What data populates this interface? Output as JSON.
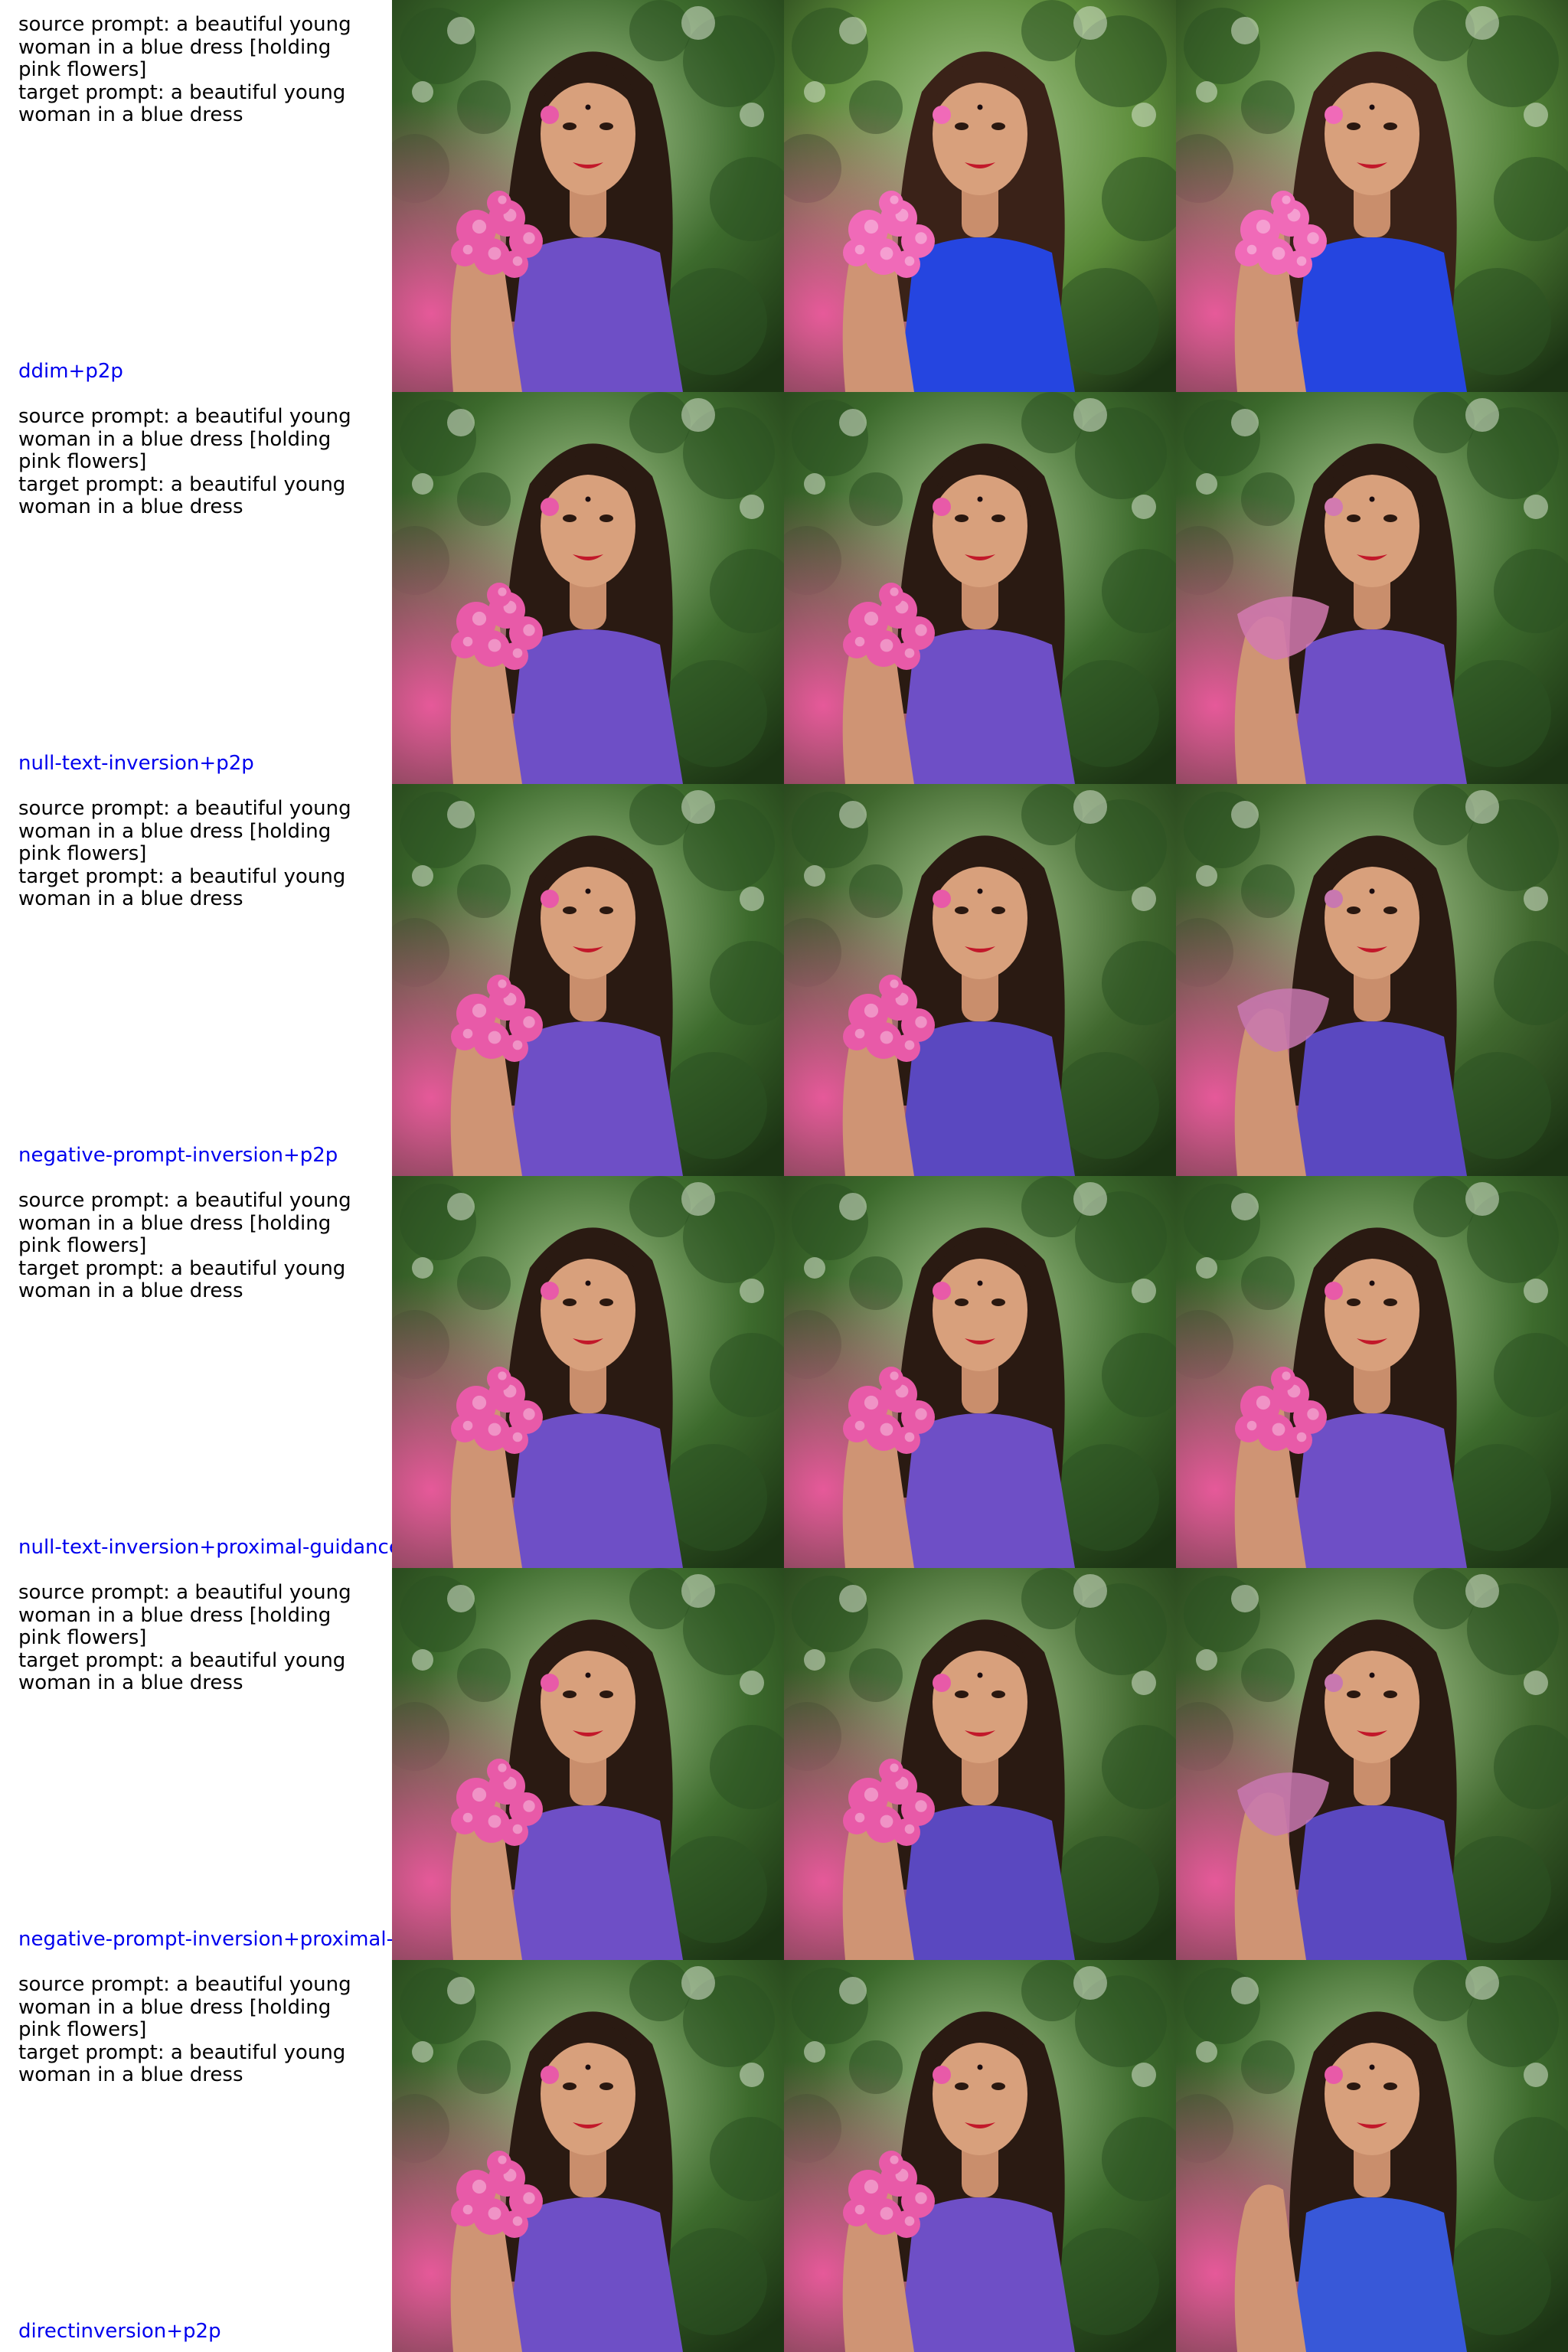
{
  "rows": [
    {
      "source_prompt": "source prompt: a beautiful young woman in a blue dress [holding pink flowers]",
      "target_prompt": "target prompt: a beautiful young woman in a blue dress",
      "method": "ddim+p2p",
      "images": [
        {
          "variant": "source",
          "bg": "#3c6a2c",
          "dress": "#6e4fc6",
          "flowers": "#e85aa8",
          "hair": "#2a1a12",
          "flower_stage": "held"
        },
        {
          "variant": "p2p-reconstruction",
          "bg": "#5c8c3a",
          "dress": "#2545e0",
          "flowers": "#f06ab8",
          "hair": "#3a2218",
          "flower_stage": "held"
        },
        {
          "variant": "edited",
          "bg": "#4e7e34",
          "dress": "#2545e0",
          "flowers": "#f06ab8",
          "hair": "#3a2218",
          "flower_stage": "held"
        }
      ]
    },
    {
      "source_prompt": "source prompt: a beautiful young woman in a blue dress [holding pink flowers]",
      "target_prompt": "target prompt: a beautiful young woman in a blue dress",
      "method": "null-text-inversion+p2p",
      "images": [
        {
          "variant": "source",
          "bg": "#3c6a2c",
          "dress": "#6e4fc6",
          "flowers": "#e85aa8",
          "hair": "#2a1a12",
          "flower_stage": "held"
        },
        {
          "variant": "reconstruction",
          "bg": "#3c6a2c",
          "dress": "#6e4fc6",
          "flowers": "#e85aa8",
          "hair": "#2a1a12",
          "flower_stage": "held"
        },
        {
          "variant": "edited",
          "bg": "#3c6a2c",
          "dress": "#6e4fc6",
          "flowers": "#d27ab0",
          "hair": "#2a1a12",
          "flower_stage": "cloth"
        }
      ]
    },
    {
      "source_prompt": "source prompt: a beautiful young woman in a blue dress [holding pink flowers]",
      "target_prompt": "target prompt: a beautiful young woman in a blue dress",
      "method": "negative-prompt-inversion+p2p",
      "images": [
        {
          "variant": "source",
          "bg": "#3c6a2c",
          "dress": "#6e4fc6",
          "flowers": "#e85aa8",
          "hair": "#2a1a12",
          "flower_stage": "held"
        },
        {
          "variant": "reconstruction",
          "bg": "#40682e",
          "dress": "#5a48c0",
          "flowers": "#e85aa8",
          "hair": "#2a1a12",
          "flower_stage": "held"
        },
        {
          "variant": "edited",
          "bg": "#40682e",
          "dress": "#5a48c0",
          "flowers": "#c878b0",
          "hair": "#2a1a12",
          "flower_stage": "cloth"
        }
      ]
    },
    {
      "source_prompt": "source prompt: a beautiful young woman in a blue dress [holding pink flowers]",
      "target_prompt": "target prompt: a beautiful young woman in a blue dress",
      "method": "null-text-inversion+proximal-guidance",
      "images": [
        {
          "variant": "source",
          "bg": "#3c6a2c",
          "dress": "#6e4fc6",
          "flowers": "#e85aa8",
          "hair": "#2a1a12",
          "flower_stage": "held"
        },
        {
          "variant": "reconstruction",
          "bg": "#3c6a2c",
          "dress": "#6e4fc6",
          "flowers": "#e85aa8",
          "hair": "#2a1a12",
          "flower_stage": "held"
        },
        {
          "variant": "edited",
          "bg": "#3c6a2c",
          "dress": "#6e4fc6",
          "flowers": "#e85aa8",
          "hair": "#2a1a12",
          "flower_stage": "held"
        }
      ]
    },
    {
      "source_prompt": "source prompt: a beautiful young woman in a blue dress [holding pink flowers]",
      "target_prompt": "target prompt: a beautiful young woman in a blue dress",
      "method": "negative-prompt-inversion+proximal-g",
      "images": [
        {
          "variant": "source",
          "bg": "#3c6a2c",
          "dress": "#6e4fc6",
          "flowers": "#e85aa8",
          "hair": "#2a1a12",
          "flower_stage": "held"
        },
        {
          "variant": "reconstruction",
          "bg": "#40682e",
          "dress": "#5a48c0",
          "flowers": "#e85aa8",
          "hair": "#2a1a12",
          "flower_stage": "held"
        },
        {
          "variant": "edited",
          "bg": "#40682e",
          "dress": "#5a48c0",
          "flowers": "#c878b0",
          "hair": "#2a1a12",
          "flower_stage": "cloth"
        }
      ]
    },
    {
      "source_prompt": "source prompt: a beautiful young woman in a blue dress [holding pink flowers]",
      "target_prompt": "target prompt: a beautiful young woman in a blue dress",
      "method": "directinversion+p2p",
      "images": [
        {
          "variant": "source",
          "bg": "#3c6a2c",
          "dress": "#6e4fc6",
          "flowers": "#e85aa8",
          "hair": "#2a1a12",
          "flower_stage": "held"
        },
        {
          "variant": "reconstruction",
          "bg": "#3c6a2c",
          "dress": "#6e4fc6",
          "flowers": "#e85aa8",
          "hair": "#2a1a12",
          "flower_stage": "held"
        },
        {
          "variant": "edited",
          "bg": "#3c6a2c",
          "dress": "#3858d8",
          "flowers": "#e85aa8",
          "hair": "#2a1a12",
          "flower_stage": "none"
        }
      ]
    }
  ]
}
